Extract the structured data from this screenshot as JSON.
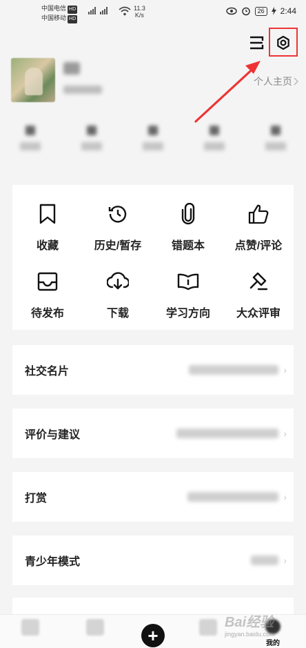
{
  "status_bar": {
    "carrier_1": "中国电信",
    "carrier_2": "中国移动",
    "hd": "HD",
    "net_speed": "11.3",
    "net_unit": "K/s",
    "battery": "26",
    "time": "2:44"
  },
  "top_actions": {
    "scan_icon": "scan-icon",
    "settings_icon": "gear-icon"
  },
  "profile": {
    "home_link": "个人主页"
  },
  "shortcuts": [
    {
      "label": "收藏",
      "icon": "bookmark-icon"
    },
    {
      "label": "历史/暂存",
      "icon": "history-icon"
    },
    {
      "label": "错题本",
      "icon": "paperclip-icon"
    },
    {
      "label": "点赞/评论",
      "icon": "thumbs-up-icon"
    },
    {
      "label": "待发布",
      "icon": "inbox-icon"
    },
    {
      "label": "下载",
      "icon": "download-icon"
    },
    {
      "label": "学习方向",
      "icon": "book-icon"
    },
    {
      "label": "大众评审",
      "icon": "gavel-icon"
    }
  ],
  "menu_rows": [
    {
      "title": "社交名片"
    },
    {
      "title": "评价与建议"
    },
    {
      "title": "打赏"
    },
    {
      "title": "青少年模式"
    }
  ],
  "tab_bar": {
    "tab_mine": "我的"
  },
  "watermark": {
    "brand": "Bai经验",
    "url": "jingyan.baidu.com"
  },
  "colors": {
    "highlight": "#e33333",
    "accent": "#111111"
  }
}
